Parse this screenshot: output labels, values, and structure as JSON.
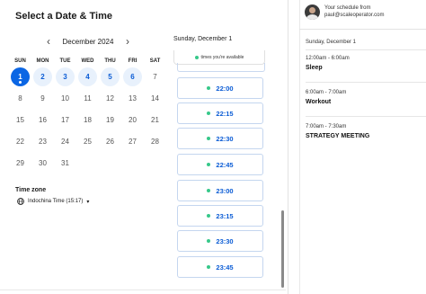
{
  "header": {
    "title": "Select a Date & Time"
  },
  "calendar": {
    "month_label": "December 2024",
    "prev_icon": "chevron-left-icon",
    "next_icon": "chevron-right-icon",
    "weekdays": [
      "SUN",
      "MON",
      "TUE",
      "WED",
      "THU",
      "FRI",
      "SAT"
    ],
    "selected_day": "1",
    "available_days": [
      "2",
      "3",
      "4",
      "5",
      "6"
    ],
    "days": [
      "1",
      "2",
      "3",
      "4",
      "5",
      "6",
      "7",
      "8",
      "9",
      "10",
      "11",
      "12",
      "13",
      "14",
      "15",
      "16",
      "17",
      "18",
      "19",
      "20",
      "21",
      "22",
      "23",
      "24",
      "25",
      "26",
      "27",
      "28",
      "29",
      "30",
      "31"
    ]
  },
  "timezone": {
    "label": "Time zone",
    "value": "Indochina Time (15:17)",
    "icon": "globe-icon"
  },
  "times": {
    "date_label": "Sunday, December 1",
    "availability_note": "times you're available",
    "slots": [
      "22:00",
      "22:15",
      "22:30",
      "22:45",
      "23:00",
      "23:15",
      "23:30",
      "23:45"
    ]
  },
  "schedule": {
    "from_label": "Your schedule from",
    "email": "paul@scaleoperator.com",
    "date_label": "Sunday, December 1",
    "events": [
      {
        "time": "12:00am - 6:00am",
        "title": "Sleep"
      },
      {
        "time": "6:00am - 7:00am",
        "title": "Workout"
      },
      {
        "time": "7:00am - 7:30am",
        "title": "STRATEGY MEETING"
      }
    ]
  },
  "colors": {
    "accent": "#0b66e4",
    "available_bg": "#e8f1fc",
    "available_dot": "#37c88a"
  }
}
